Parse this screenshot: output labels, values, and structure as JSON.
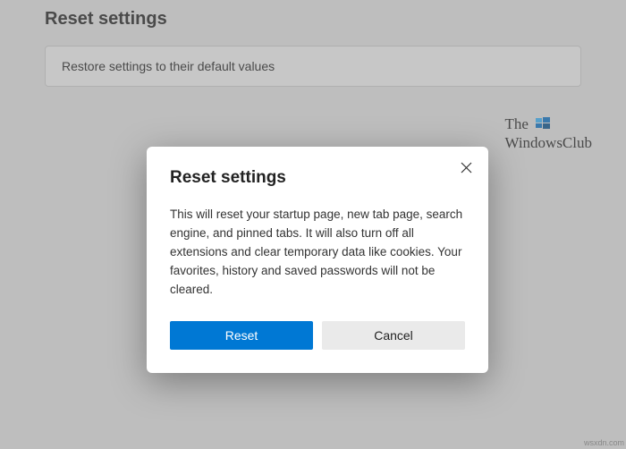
{
  "page": {
    "title": "Reset settings",
    "row_label": "Restore settings to their default values"
  },
  "watermark": {
    "line1": "The",
    "line2": "WindowsClub"
  },
  "dialog": {
    "title": "Reset settings",
    "body": "This will reset your startup page, new tab page, search engine, and pinned tabs. It will also turn off all extensions and clear temporary data like cookies. Your favorites, history and saved passwords will not be cleared.",
    "primary_label": "Reset",
    "secondary_label": "Cancel"
  },
  "footer": {
    "mark": "wsxdn.com"
  }
}
